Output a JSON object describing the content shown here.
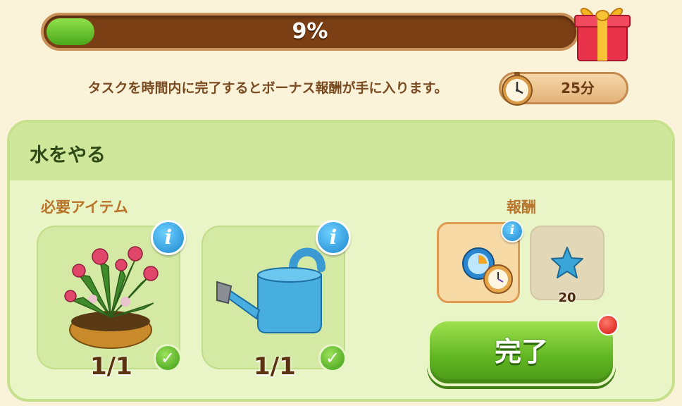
{
  "header": {
    "progress_percent": 9,
    "progress_label": "9%",
    "subtitle": "タスクを時間内に完了するとボーナス報酬が手に入ります。",
    "timer_label": "25分"
  },
  "task": {
    "title": "水をやる",
    "required_label": "必要アイテム",
    "items": [
      {
        "name": "peony-plant",
        "count": "1/1",
        "complete": true
      },
      {
        "name": "watering-can",
        "count": "1/1",
        "complete": true
      }
    ],
    "reward_label": "報酬",
    "rewards": [
      {
        "icon": "speed-up-clock-icon"
      },
      {
        "icon": "blue-star-icon",
        "value": "20"
      }
    ],
    "complete_button": "完了"
  },
  "colors": {
    "progress_fill": "#5fc22a",
    "progress_track": "#7a3f14",
    "panel_bg": "#e9f5c6",
    "accent_green": "#5fb421",
    "label_orange": "#b9742c",
    "info_blue": "#1c87cf"
  }
}
